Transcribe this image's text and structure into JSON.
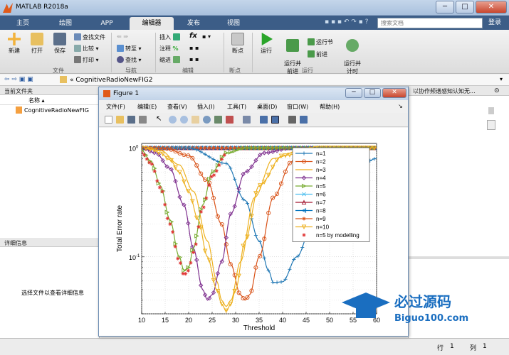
{
  "window": {
    "title": "MATLAB R2018a",
    "min": "─",
    "max": "□",
    "close": "✕"
  },
  "tabs": [
    "主页",
    "绘图",
    "APP",
    "编辑器",
    "发布",
    "视图"
  ],
  "search_placeholder": "搜索文档",
  "login": "登录",
  "ribbon": {
    "file": {
      "new": "新建",
      "open": "打开",
      "save": "保存",
      "find_files": "查找文件",
      "compare": "比较",
      "print": "打印",
      "group": "文件"
    },
    "nav": {
      "goto": "转至",
      "find": "查找",
      "group": "导航"
    },
    "edit": {
      "insert": "插入",
      "comment": "注释",
      "indent": "缩进",
      "fx": "fx",
      "group": "编辑"
    },
    "breakpoints": {
      "bp": "断点",
      "group": "断点"
    },
    "run": {
      "run": "运行",
      "run_advance": "运行并\n前进",
      "run_section": "运行节",
      "advance": "前进",
      "run_time": "运行并\n计时",
      "group": "运行"
    }
  },
  "address": {
    "path": "« CognitiveRadioNewFIG2"
  },
  "current_folder": {
    "title": "当前文件夹",
    "col_name": "名称",
    "file": "CognitiveRadioNewFIG",
    "details_title": "详细信息",
    "details_msg": "选择文件以查看详细信息"
  },
  "right_panel": {
    "text": "以协作频谱感知认知无..."
  },
  "status": {
    "row_label": "行",
    "row": "1",
    "col_label": "列",
    "col": "1"
  },
  "figure": {
    "title": "Figure 1",
    "menu": [
      "文件(F)",
      "编辑(E)",
      "查看(V)",
      "插入(I)",
      "工具(T)",
      "桌面(D)",
      "窗口(W)",
      "帮助(H)"
    ]
  },
  "watermark": {
    "cn": "必过源码",
    "en": "Biguo100.com"
  },
  "chart_data": {
    "type": "line",
    "xlabel": "Threshold",
    "ylabel": "Total Error rate",
    "xlim": [
      10,
      60
    ],
    "ylim": [
      0.03,
      1.1
    ],
    "yscale": "log",
    "xticks": [
      "10",
      "15",
      "20",
      "25",
      "30",
      "35",
      "40",
      "45",
      "50",
      "55",
      "60"
    ],
    "yticks": [
      "10^0",
      "10^-1"
    ],
    "grid": true,
    "legend_position": "top-right",
    "series": [
      {
        "name": "n=1",
        "color": "#1f77b4",
        "marker": "plus",
        "x": [
          10,
          20,
          28,
          32,
          35,
          37,
          38,
          40,
          43,
          47,
          52,
          57,
          60
        ],
        "y": [
          1,
          1,
          0.72,
          0.33,
          0.14,
          0.075,
          0.058,
          0.059,
          0.1,
          0.25,
          0.5,
          0.72,
          0.8
        ]
      },
      {
        "name": "n=2",
        "color": "#d95319",
        "marker": "circle",
        "x": [
          10,
          15,
          20,
          24,
          27,
          29,
          31,
          32,
          33,
          35,
          38,
          42,
          48,
          55,
          60
        ],
        "y": [
          1,
          0.99,
          0.85,
          0.5,
          0.2,
          0.085,
          0.045,
          0.04,
          0.045,
          0.1,
          0.35,
          0.75,
          0.97,
          1,
          1
        ]
      },
      {
        "name": "n=3",
        "color": "#edb120",
        "marker": "none",
        "x": [
          10,
          14,
          18,
          21,
          24,
          26,
          27,
          28,
          29,
          31,
          34,
          38,
          45,
          55,
          60
        ],
        "y": [
          1,
          0.95,
          0.7,
          0.4,
          0.14,
          0.06,
          0.04,
          0.035,
          0.04,
          0.09,
          0.35,
          0.8,
          1,
          1,
          1
        ]
      },
      {
        "name": "n=4",
        "color": "#7e2f8e",
        "marker": "diamond",
        "x": [
          10,
          13,
          16,
          19,
          21,
          23,
          24,
          25,
          27,
          29,
          32,
          36,
          42,
          50,
          60
        ],
        "y": [
          1,
          0.9,
          0.65,
          0.3,
          0.12,
          0.05,
          0.04,
          0.045,
          0.09,
          0.25,
          0.6,
          0.9,
          1,
          1,
          1
        ]
      },
      {
        "name": "n=5",
        "color": "#77ac30",
        "marker": "triangle-right",
        "x": [
          10,
          12,
          14,
          16,
          18,
          19,
          20,
          21,
          23,
          25,
          28,
          32,
          38,
          45,
          60
        ],
        "y": [
          0.95,
          0.75,
          0.45,
          0.22,
          0.1,
          0.075,
          0.08,
          0.12,
          0.3,
          0.6,
          0.9,
          1,
          1,
          1,
          1
        ]
      },
      {
        "name": "n=6",
        "color": "#4dbeee",
        "marker": "x",
        "x": [
          10,
          15,
          20,
          30,
          40,
          50,
          60
        ],
        "y": [
          1,
          1,
          1,
          1,
          1,
          1,
          1
        ]
      },
      {
        "name": "n=7",
        "color": "#a2142f",
        "marker": "triangle-up",
        "x": [
          10,
          15,
          20,
          30,
          40,
          50,
          60
        ],
        "y": [
          1,
          1,
          1,
          1,
          1,
          1,
          1
        ]
      },
      {
        "name": "n=8",
        "color": "#0072bd",
        "marker": "triangle-left",
        "x": [
          10,
          15,
          20,
          30,
          40,
          50,
          60
        ],
        "y": [
          1,
          1,
          1,
          1,
          1,
          1,
          1
        ]
      },
      {
        "name": "n=9",
        "color": "#d95319",
        "marker": "asterisk",
        "x": [
          10,
          15,
          20,
          30,
          40,
          50,
          60
        ],
        "y": [
          1,
          1,
          1,
          1,
          1,
          1,
          1
        ]
      },
      {
        "name": "n=10",
        "color": "#edb120",
        "marker": "triangle-down",
        "x": [
          10,
          12,
          14,
          16,
          18,
          20,
          22,
          24,
          26,
          27,
          28,
          29,
          30,
          32,
          35,
          40,
          48,
          60
        ],
        "y": [
          1,
          0.97,
          0.9,
          0.78,
          0.6,
          0.4,
          0.22,
          0.1,
          0.05,
          0.037,
          0.032,
          0.037,
          0.05,
          0.14,
          0.45,
          0.85,
          1,
          1
        ]
      },
      {
        "name": "n=5 by modelling",
        "color": "#e03030",
        "marker": "asterisk-only",
        "x": [
          10,
          12,
          14,
          16,
          18,
          19,
          20,
          21,
          23,
          25,
          28
        ],
        "y": [
          0.9,
          0.72,
          0.43,
          0.2,
          0.092,
          0.068,
          0.075,
          0.11,
          0.28,
          0.55,
          0.88
        ]
      }
    ]
  }
}
